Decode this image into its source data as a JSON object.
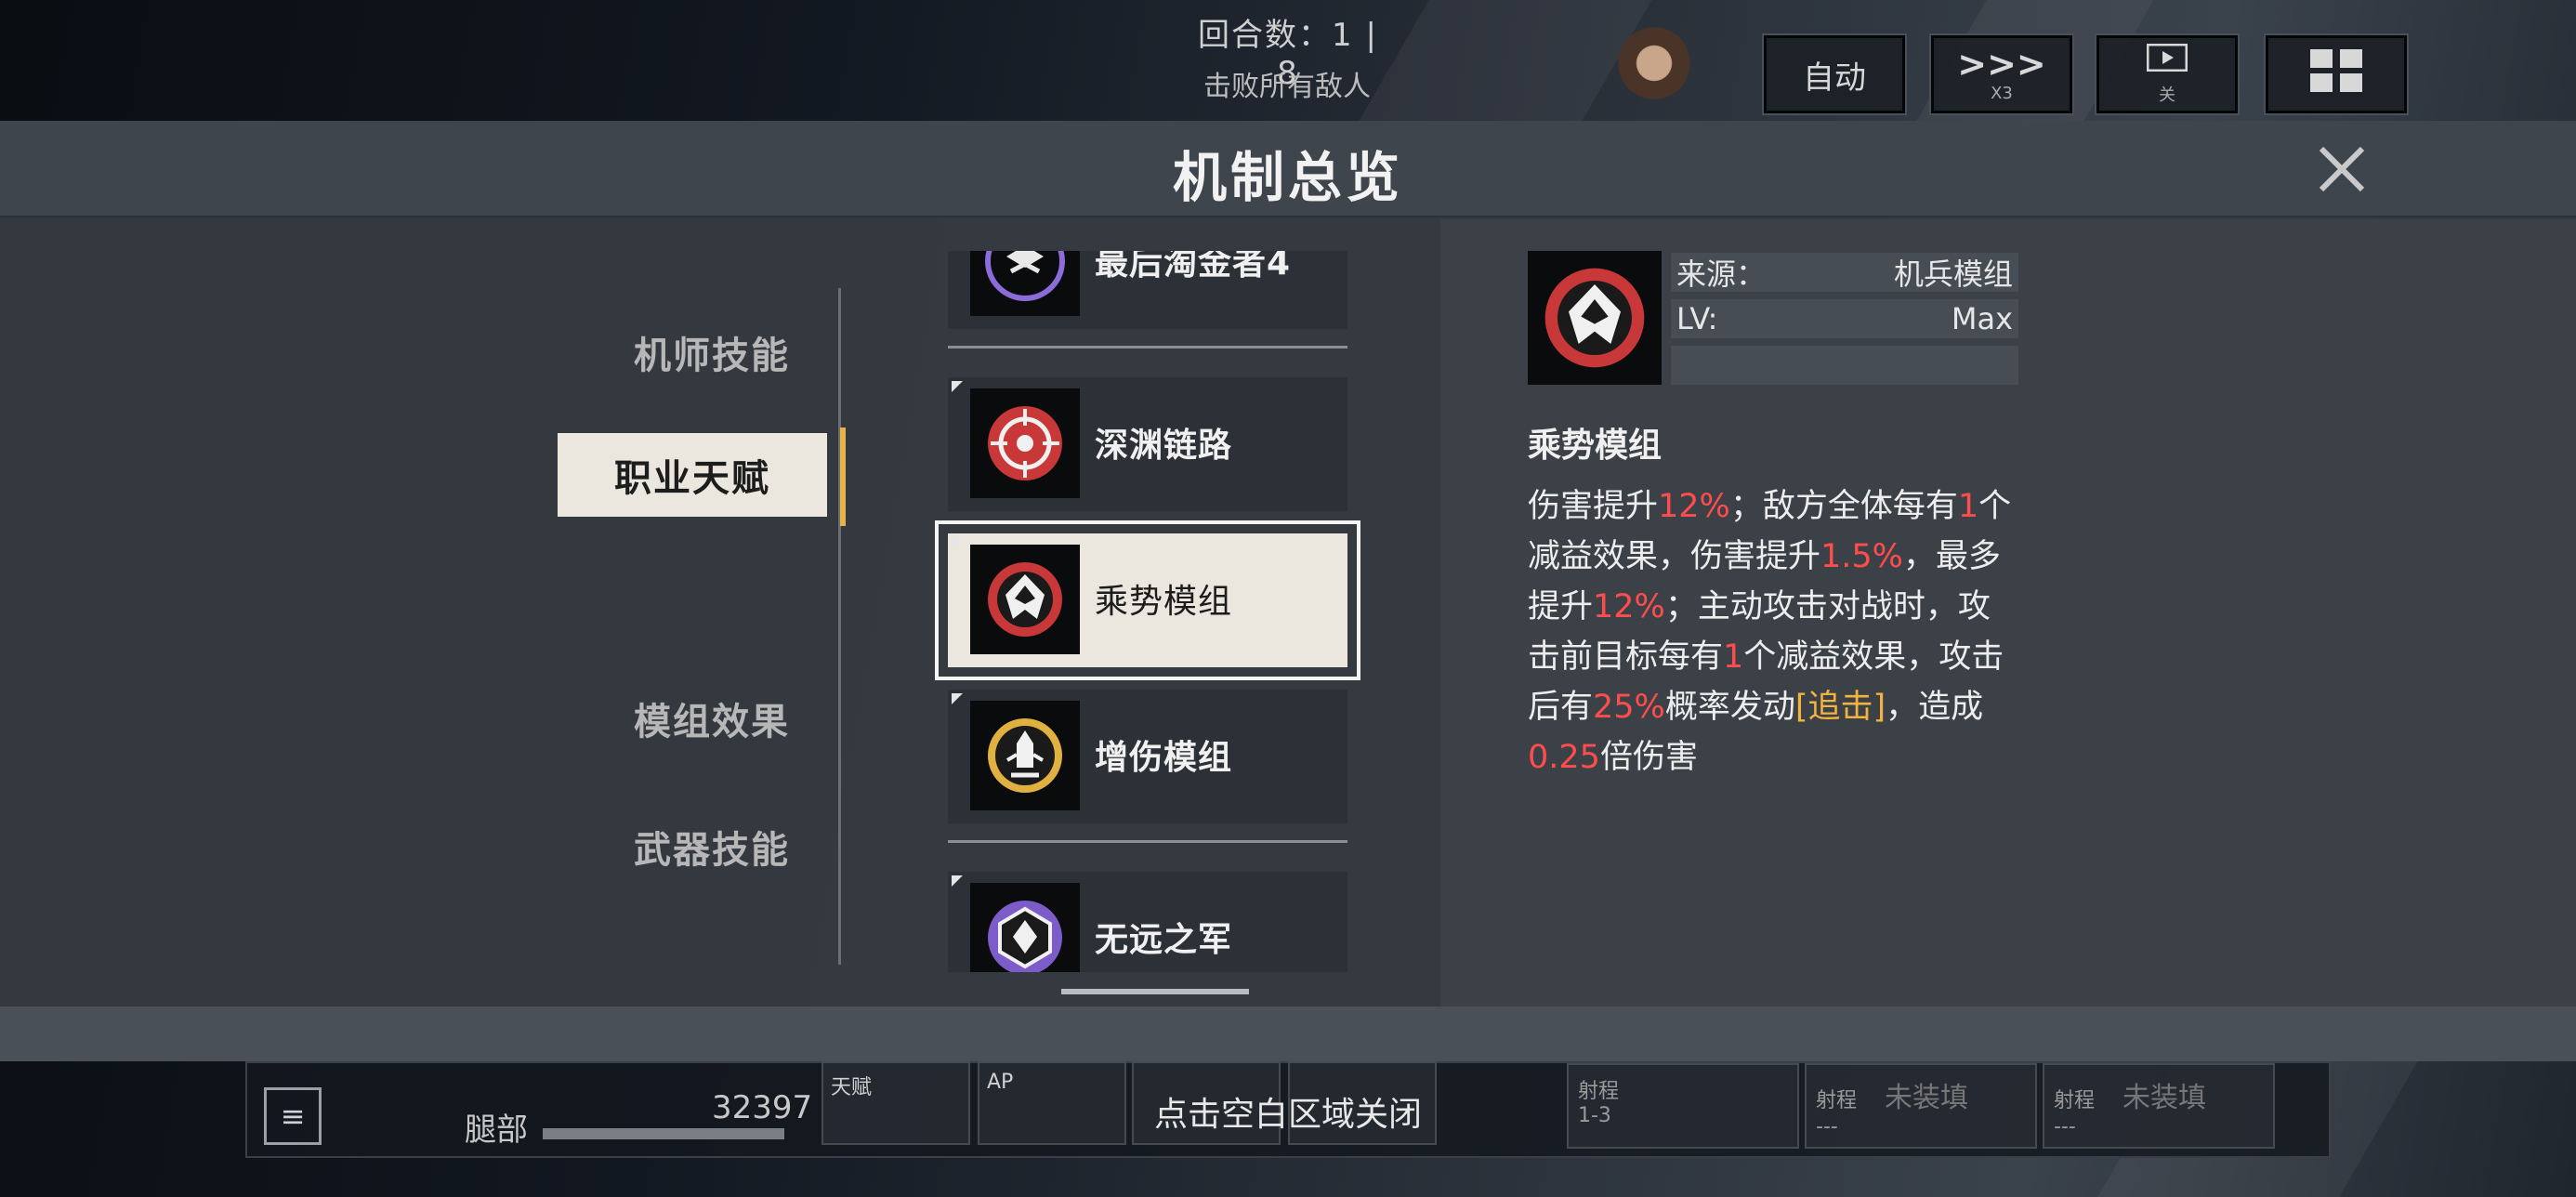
{
  "hud": {
    "turn_label": "回合数：1 | 8",
    "objective": "击败所有敌人",
    "auto_label": "自动",
    "speed_icon": ">>>",
    "speed_sub": "X3",
    "film_sub": "关",
    "hp_label": "腿部",
    "hp_value": "32397",
    "hint": "点击空白区域关闭",
    "skill_labels": [
      "天赋",
      "AP",
      ""
    ],
    "weapon_slots": [
      {
        "label": "射程",
        "value": "1-3",
        "title": ""
      },
      {
        "label": "射程",
        "value": "---",
        "title": "未装填"
      },
      {
        "label": "射程",
        "value": "---",
        "title": "未装填"
      }
    ]
  },
  "modal": {
    "title": "机制总览",
    "tabs": [
      {
        "label": "机师技能",
        "active": false
      },
      {
        "label": "职业天赋",
        "active": true
      },
      {
        "label": "模组效果",
        "active": false
      },
      {
        "label": "武器技能",
        "active": false
      }
    ],
    "list": [
      {
        "name": "最后淘金者4",
        "icon": "purple-emblem-icon"
      },
      {
        "name": "深渊链路",
        "icon": "red-crosshair-icon"
      },
      {
        "name": "乘势模组",
        "icon": "red-mech-head-icon",
        "selected": true
      },
      {
        "name": "增伤模组",
        "icon": "gold-missile-icon"
      },
      {
        "name": "无远之军",
        "icon": "purple-hex-icon"
      }
    ],
    "detail": {
      "icon": "red-mech-head-icon",
      "source_label": "来源：",
      "source_value": "机兵模组",
      "lv_label": "LV:",
      "lv_value": "Max",
      "name": "乘势模组",
      "desc": {
        "p1": "伤害提升",
        "v1": "12%",
        "p2": "；敌方全体每有",
        "v2": "1",
        "p3": "个减益效果，伤害提升",
        "v3": "1.5%",
        "p4": "，最多提升",
        "v4": "12%",
        "p5": "；主动攻击对战时，攻击前目标每有",
        "v5": "1",
        "p6": "个减益效果，攻击后有",
        "v6": "25%",
        "p7": "概率发动",
        "v7": "[追击]",
        "p8": "，造成",
        "v8": "0.25",
        "p9": "倍伤害"
      }
    },
    "colors": {
      "accent": "#e6b34a",
      "highlight": "#ff4d4d",
      "keyword": "#f2b43c"
    }
  }
}
